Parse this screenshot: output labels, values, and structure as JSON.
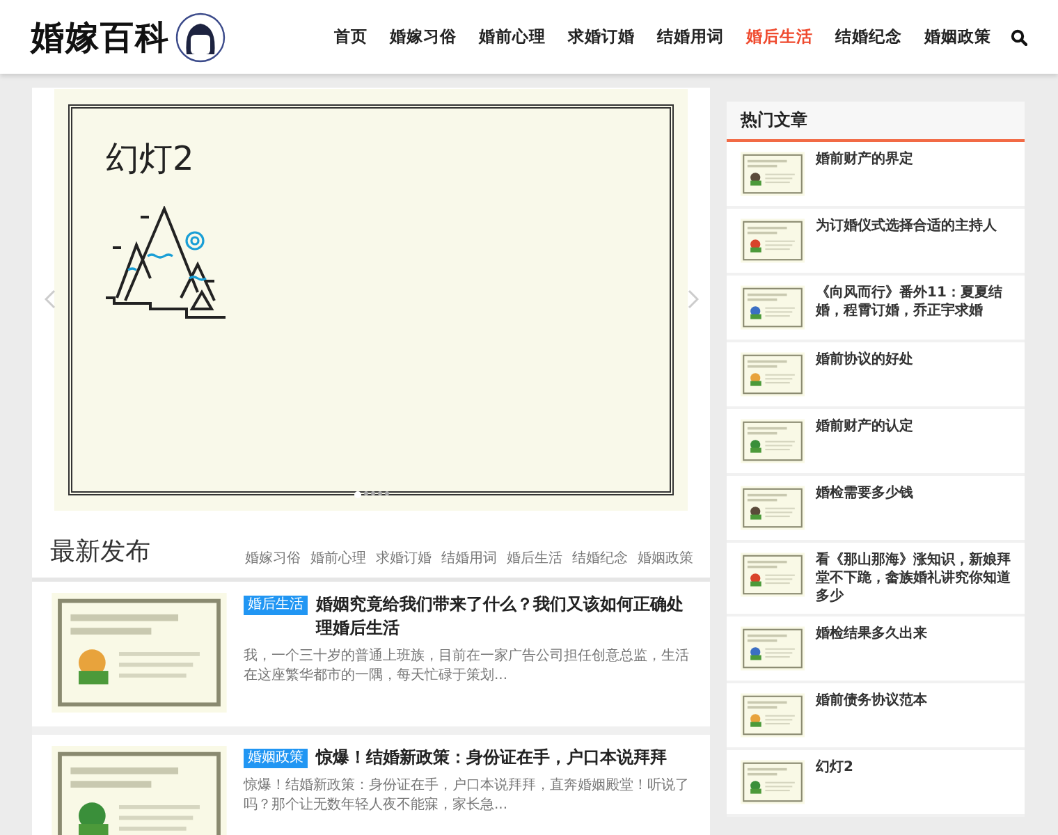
{
  "header": {
    "logo": "婚嫁百科",
    "nav": [
      {
        "label": "首页",
        "selected": false
      },
      {
        "label": "婚嫁习俗",
        "selected": false
      },
      {
        "label": "婚前心理",
        "selected": false
      },
      {
        "label": "求婚订婚",
        "selected": false
      },
      {
        "label": "结婚用词",
        "selected": false
      },
      {
        "label": "婚后生活",
        "selected": true
      },
      {
        "label": "结婚纪念",
        "selected": false
      },
      {
        "label": "婚姻政策",
        "selected": false
      }
    ]
  },
  "slider": {
    "slide_title": "幻灯2",
    "dots": [
      {
        "selected": true
      },
      {
        "selected": false
      },
      {
        "selected": false
      },
      {
        "selected": false
      },
      {
        "selected": false
      }
    ]
  },
  "latest": {
    "title": "最新发布",
    "tabs": [
      "婚嫁习俗",
      "婚前心理",
      "求婚订婚",
      "结婚用词",
      "婚后生活",
      "结婚纪念",
      "婚姻政策"
    ],
    "posts": [
      {
        "tag": "婚后生活",
        "title": "婚姻究竟给我们带来了什么？我们又该如何正确处理婚后生活",
        "excerpt": "我，一个三十岁的普通上班族，目前在一家广告公司担任创意总监，生活在这座繁华都市的一隅，每天忙碌于策划..."
      },
      {
        "tag": "婚姻政策",
        "title": "惊爆！结婚新政策：身份证在手，户口本说拜拜",
        "excerpt": "惊爆！结婚新政策：身份证在手，户口本说拜拜，直奔婚姻殿堂！听说了吗？那个让无数年轻人夜不能寐，家长急..."
      }
    ]
  },
  "sidebar": {
    "title": "热门文章",
    "items": [
      "婚前财产的界定",
      "为订婚仪式选择合适的主持人",
      "《向风而行》番外11：夏夏结婚，程霄订婚，乔正宇求婚",
      "婚前协议的好处",
      "婚前财产的认定",
      "婚检需要多少钱",
      "看《那山那海》涨知识，新娘拜堂不下跪，畲族婚礼讲究你知道多少",
      "婚检结果多久出来",
      "婚前债务协议范本",
      "幻灯2"
    ]
  }
}
